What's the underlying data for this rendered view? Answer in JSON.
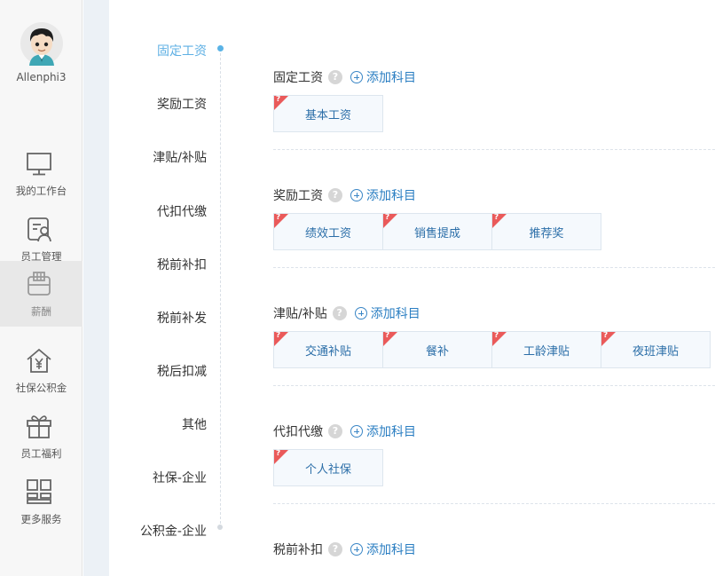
{
  "user": {
    "name": "Allenphi3"
  },
  "nav": {
    "items": [
      {
        "label": "我的工作台",
        "icon": "monitor-icon",
        "active": false
      },
      {
        "label": "员工管理",
        "icon": "employee-card-icon",
        "active": false
      },
      {
        "label": "薪酬",
        "icon": "wallet-icon",
        "active": true
      },
      {
        "label": "社保公积金",
        "icon": "house-yen-icon",
        "active": false
      },
      {
        "label": "员工福利",
        "icon": "gift-icon",
        "active": false
      },
      {
        "label": "更多服务",
        "icon": "grid-icon",
        "active": false
      }
    ]
  },
  "subnav": {
    "items": [
      {
        "label": "固定工资",
        "active": true
      },
      {
        "label": "奖励工资"
      },
      {
        "label": "津贴/补贴"
      },
      {
        "label": "代扣代缴"
      },
      {
        "label": "税前补扣"
      },
      {
        "label": "税前补发"
      },
      {
        "label": "税后扣减"
      },
      {
        "label": "其他"
      },
      {
        "label": "社保-企业"
      },
      {
        "label": "公积金-企业"
      }
    ]
  },
  "help_glyph": "?",
  "chip_flag_glyph": "?",
  "add_label": "添加科目",
  "sections": [
    {
      "title": "固定工资",
      "items": [
        "基本工资"
      ]
    },
    {
      "title": "奖励工资",
      "items": [
        "绩效工资",
        "销售提成",
        "推荐奖"
      ]
    },
    {
      "title": "津贴/补贴",
      "items": [
        "交通补贴",
        "餐补",
        "工龄津贴",
        "夜班津贴"
      ]
    },
    {
      "title": "代扣代缴",
      "items": [
        "个人社保"
      ]
    },
    {
      "title": "税前补扣",
      "items": []
    }
  ],
  "colors": {
    "accent": "#5fb0e4",
    "link": "#2a7ec2",
    "flag": "#ea5a5a",
    "chip_text": "#2b6ea8"
  }
}
